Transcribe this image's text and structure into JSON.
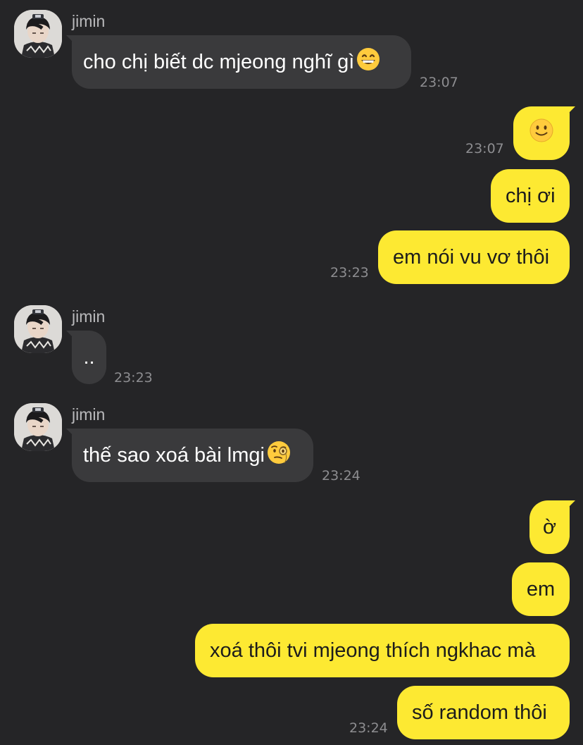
{
  "colors": {
    "background": "#252527",
    "incoming_bubble": "#3a3a3c",
    "outgoing_bubble": "#fde932",
    "timestamp": "#8d8d90",
    "sender_name": "#b9b9bb"
  },
  "messages": [
    {
      "direction": "incoming",
      "sender": "jimin",
      "text": "cho chị biết dc mjeong nghĩ gì",
      "emoji": "grinning-face-icon",
      "time": "23:07"
    },
    {
      "direction": "outgoing",
      "text": "",
      "emoji": "slightly-smiling-face-icon",
      "time": "23:07"
    },
    {
      "direction": "outgoing",
      "text": "chị ơi",
      "time": ""
    },
    {
      "direction": "outgoing",
      "text": "em nói vu vơ thôi",
      "time": "23:23"
    },
    {
      "direction": "incoming",
      "sender": "jimin",
      "text": "..",
      "time": "23:23"
    },
    {
      "direction": "incoming",
      "sender": "jimin",
      "text": "thế sao xoá bài lmgi",
      "emoji": "face-with-monocle-icon",
      "time": "23:24"
    },
    {
      "direction": "outgoing",
      "text": "ờ",
      "time": ""
    },
    {
      "direction": "outgoing",
      "text": "em",
      "time": ""
    },
    {
      "direction": "outgoing",
      "text": "xoá thôi tvi mjeong thích ngkhac mà",
      "time": ""
    },
    {
      "direction": "outgoing",
      "text": "số random thôi",
      "time": "23:24"
    }
  ]
}
